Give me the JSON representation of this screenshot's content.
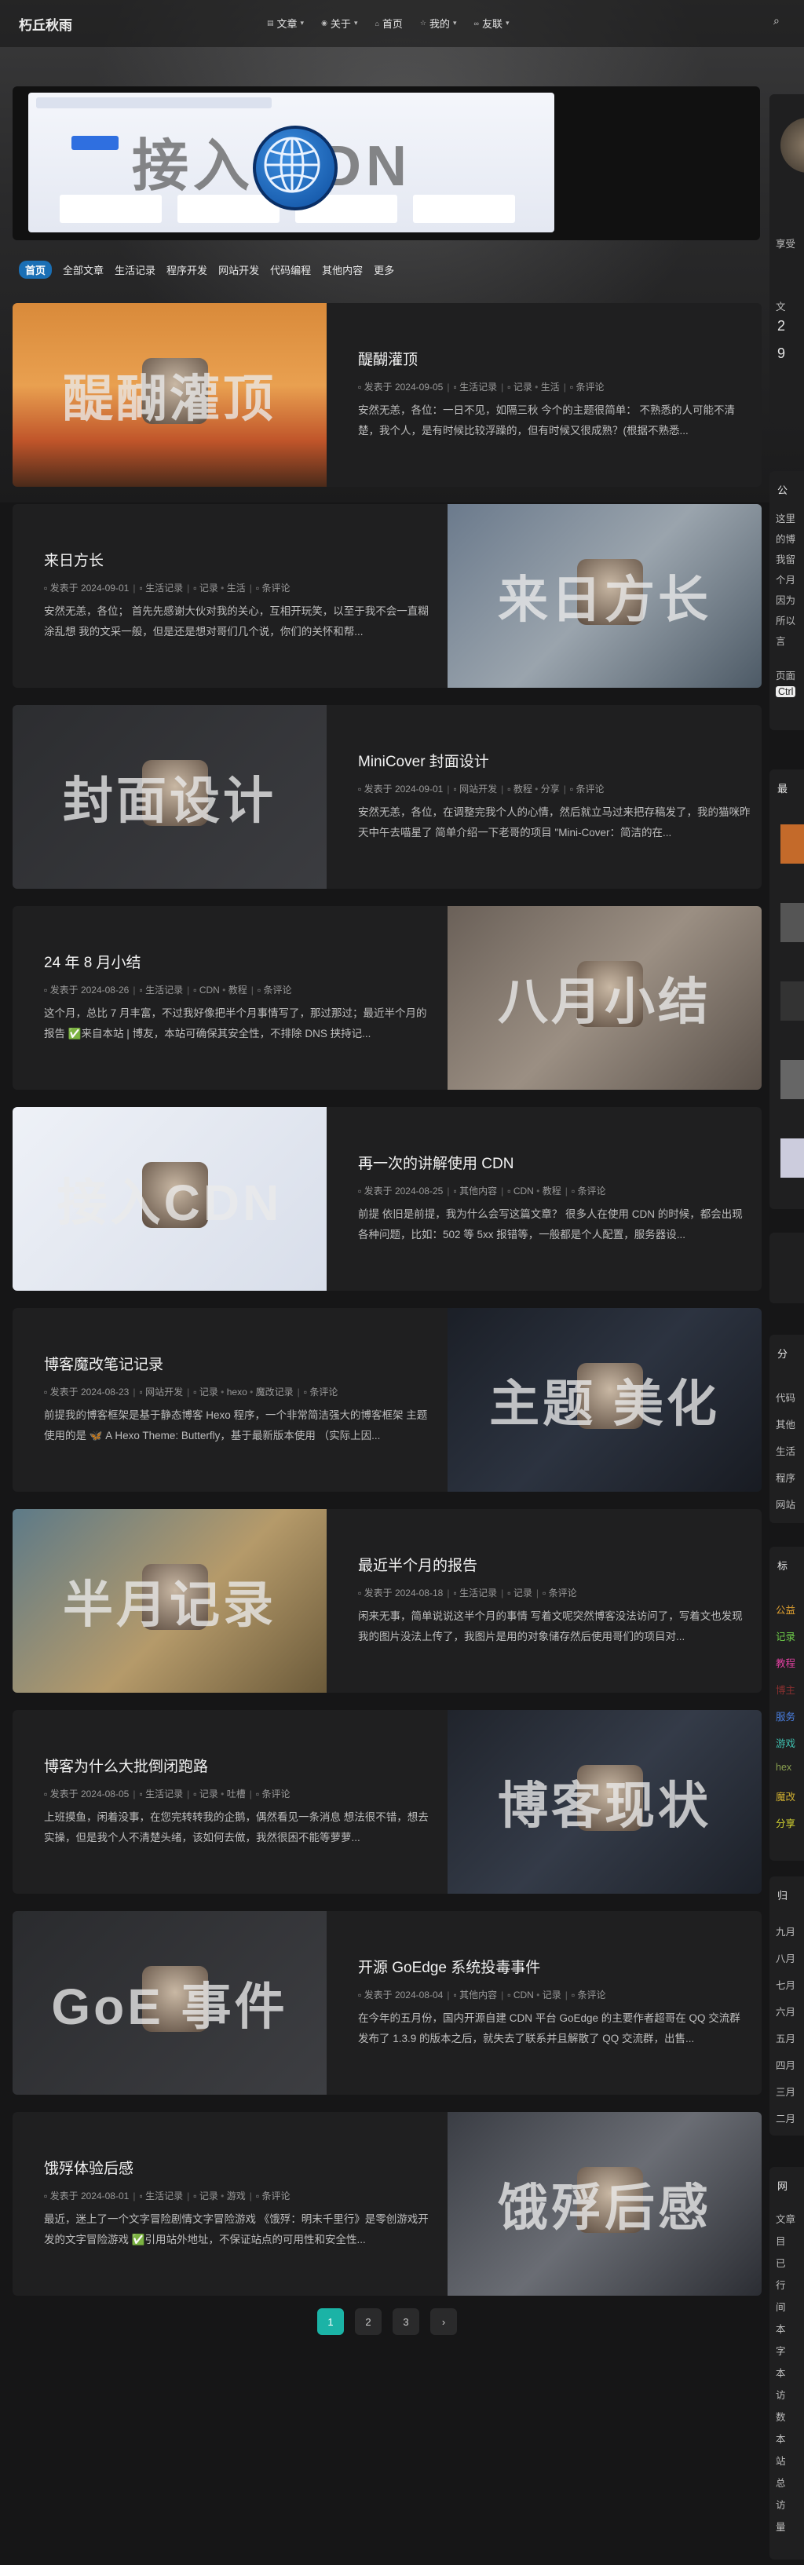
{
  "site": {
    "brand": "朽丘秋雨"
  },
  "nav": {
    "items": [
      {
        "label": "文章",
        "icon": "doc-icon"
      },
      {
        "label": "关于",
        "icon": "user-icon"
      },
      {
        "label": "首页",
        "icon": "home-icon"
      },
      {
        "label": "我的",
        "icon": "star-icon"
      },
      {
        "label": "友联",
        "icon": "link-icon"
      }
    ]
  },
  "banner": {
    "title": "接入 CDN"
  },
  "categories": {
    "active": "首页",
    "items": [
      "全部文章",
      "生活记录",
      "程序开发",
      "网站开发",
      "代码编程",
      "其他内容",
      "更多"
    ]
  },
  "posts": [
    {
      "title": "醍醐灌顶",
      "cover_text": "醍醐灌顶",
      "date": "发表于 2024-09-05",
      "category": "生活记录",
      "tags": [
        "记录",
        "生活"
      ],
      "comments": "条评论",
      "excerpt": "安然无恙，各位：一日不见，如隔三秋 今个的主题很简单： 不熟悉的人可能不清楚，我个人，是有时候比较浮躁的，但有时候又很成熟？(根据不熟悉..."
    },
    {
      "title": "来日方长",
      "cover_text": "来日方长",
      "date": "发表于 2024-09-01",
      "category": "生活记录",
      "tags": [
        "记录",
        "生活"
      ],
      "comments": "条评论",
      "excerpt": "安然无恙，各位； 首先先感谢大伙对我的关心，互相开玩笑，以至于我不会一直糊涂乱想 我的文采一般，但是还是想对哥们几个说，你们的关怀和帮..."
    },
    {
      "title": "MiniCover 封面设计",
      "cover_text": "封面设计",
      "date": "发表于 2024-09-01",
      "category": "网站开发",
      "tags": [
        "教程",
        "分享"
      ],
      "comments": "条评论",
      "excerpt": "安然无恙，各位，在调整完我个人的心情，然后就立马过来把存稿发了，我的猫咪昨天中午去喵星了 简单介绍一下老哥的项目 \"Mini-Cover：简洁的在..."
    },
    {
      "title": "24 年 8 月小结",
      "cover_text": "八月小结",
      "date": "发表于 2024-08-26",
      "category": "生活记录",
      "tags": [
        "CDN",
        "教程"
      ],
      "comments": "条评论",
      "excerpt": "这个月，总比 7 月丰富，不过我好像把半个月事情写了，那过那过；最近半个月的报告 ✅来自本站 | 博友，本站可确保其安全性，不排除 DNS 挟持记..."
    },
    {
      "title": "再一次的讲解使用 CDN",
      "cover_text": "接入CDN",
      "date": "发表于 2024-08-25",
      "category": "其他内容",
      "tags": [
        "CDN",
        "教程"
      ],
      "comments": "条评论",
      "excerpt": "前提 依旧是前提，我为什么会写这篇文章？ 很多人在使用 CDN 的时候，都会出现各种问题，比如：502 等 5xx 报错等，一般都是个人配置，服务器设..."
    },
    {
      "title": "博客魔改笔记记录",
      "cover_text": "主题 美化",
      "date": "发表于 2024-08-23",
      "category": "网站开发",
      "tags": [
        "记录",
        "hexo",
        "魔改记录"
      ],
      "comments": "条评论",
      "excerpt": "前提我的博客框架是基于静态博客 Hexo 程序，一个非常简洁强大的博客框架 主题使用的是 🦋 A Hexo Theme: Butterfly，基于最新版本使用 （实际上因..."
    },
    {
      "title": "最近半个月的报告",
      "cover_text": "半月记录",
      "date": "发表于 2024-08-18",
      "category": "生活记录",
      "tags": [
        "记录"
      ],
      "comments": "条评论",
      "excerpt": "闲来无事，简单说说这半个月的事情 写着文呢突然博客没法访问了，写着文也发现我的图片没法上传了，我图片是用的对象储存然后使用哥们的项目对..."
    },
    {
      "title": "博客为什么大批倒闭跑路",
      "cover_text": "博客现状",
      "date": "发表于 2024-08-05",
      "category": "生活记录",
      "tags": [
        "记录",
        "吐槽"
      ],
      "comments": "条评论",
      "excerpt": "上班摸鱼，闲着没事，在您完转转我的企鹅，偶然看见一条消息 想法很不错，想去实操，但是我个人不清楚头绪，该如何去做，我然很困不能等萝萝..."
    },
    {
      "title": "开源 GoEdge 系统投毒事件",
      "cover_text": "GoE 事件",
      "date": "发表于 2024-08-04",
      "category": "其他内容",
      "tags": [
        "CDN",
        "记录"
      ],
      "comments": "条评论",
      "excerpt": "在今年的五月份，国内开源自建 CDN 平台 GoEdge 的主要作者超哥在 QQ 交流群发布了 1.3.9 的版本之后，就失去了联系并且解散了 QQ 交流群，出售..."
    },
    {
      "title": "饿殍体验后感",
      "cover_text": "饿殍后感",
      "date": "发表于 2024-08-01",
      "category": "生活记录",
      "tags": [
        "记录",
        "游戏"
      ],
      "comments": "条评论",
      "excerpt": "最近，迷上了一个文字冒险剧情文字冒险游戏 《饿殍：明末千里行》是零创游戏开发的文字冒险游戏 ✅引用站外地址，不保证站点的可用性和安全性..."
    }
  ],
  "pagination": {
    "pages": [
      "1",
      "2",
      "3"
    ],
    "current": "1",
    "next": "›"
  },
  "sidebar": {
    "profile_tag": "享受",
    "stats": [
      "文",
      "2",
      "9"
    ],
    "notice_title": "公",
    "notice_lines": [
      "这里",
      "的博",
      "我留",
      "个月",
      "因为",
      "所以",
      "言"
    ],
    "notice_foot": "页面",
    "notice_badge": "Ctrl",
    "recent_title": "最",
    "cat_title": "分",
    "cat_items": [
      "代码",
      "其他",
      "生活",
      "程序",
      "网站"
    ],
    "tag_title": "标",
    "tag_items": [
      "公益",
      "记录",
      "教程",
      "博主",
      "服务",
      "游戏",
      "hex",
      "魔改",
      "分享"
    ],
    "archive_title": "归",
    "archive_items": [
      "九月",
      "八月",
      "七月",
      "六月",
      "五月",
      "四月",
      "三月",
      "二月"
    ],
    "site_title": "网",
    "site_items": [
      "文章",
      "目",
      "已",
      "行",
      "间",
      "本",
      "字",
      "本",
      "访",
      "数",
      "本",
      "站",
      "总",
      "访",
      "量"
    ]
  },
  "colors": {
    "accent": "#1bb3a6",
    "tab_active": "#1a6fb5",
    "card_bg": "#1f1f20",
    "page_bg": "#161617"
  }
}
